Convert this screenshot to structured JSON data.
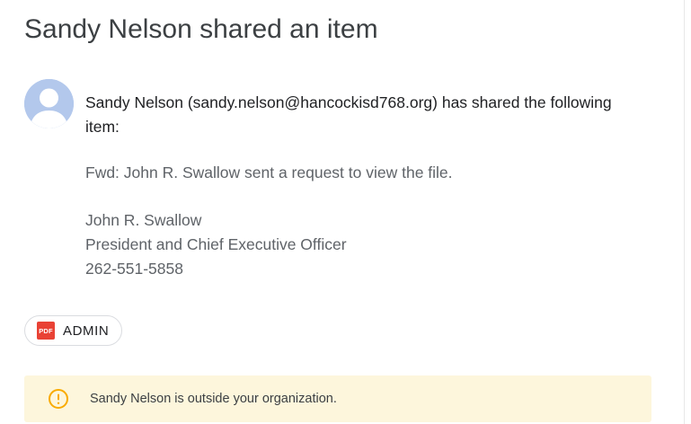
{
  "header": {
    "title": "Sandy Nelson shared an item"
  },
  "message": {
    "intro": "Sandy Nelson (sandy.nelson@hancockisd768.org) has shared the following item:",
    "item_subject": "Fwd: John R. Swallow sent a request to view the file.",
    "signature_name": "John R. Swallow",
    "signature_title": "President and Chief Executive Officer",
    "signature_phone": "262-551-5858"
  },
  "attachment": {
    "icon_label": "PDF",
    "icon": "pdf-file-icon",
    "name": "ADMIN",
    "icon_color": "#e94235"
  },
  "notice": {
    "text": "Sandy Nelson is outside your organization.",
    "icon": "warning-circle-icon",
    "background_color": "#fdf6dc",
    "icon_color": "#f9ab00"
  },
  "avatar": {
    "icon": "default-user-avatar-icon",
    "background_color": "#b3c8ec"
  }
}
